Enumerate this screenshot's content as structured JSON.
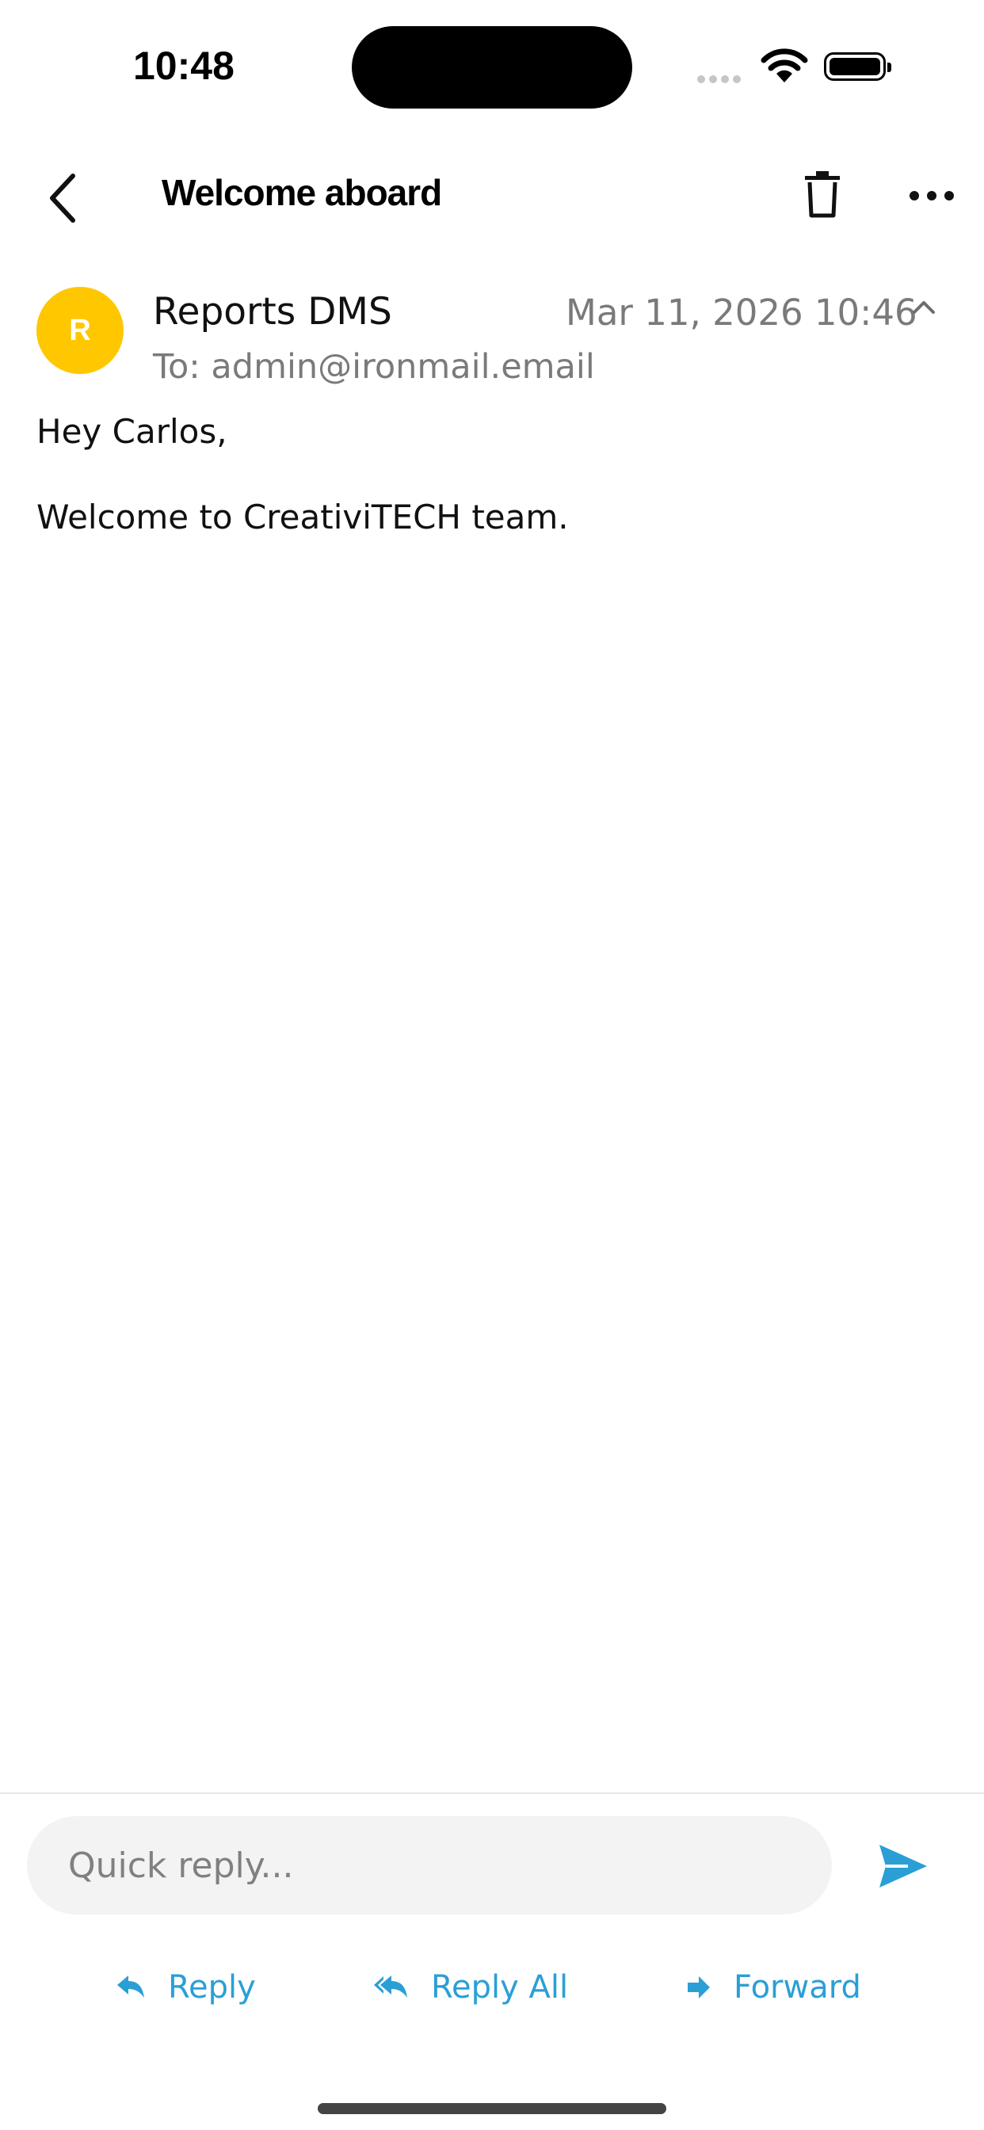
{
  "status_bar": {
    "time": "10:48"
  },
  "header": {
    "title": "Welcome aboard"
  },
  "message": {
    "avatar_initial": "R",
    "avatar_color": "#FFC700",
    "sender": "Reports DMS",
    "date": "Mar 11, 2026 10:46",
    "to": "To: admin@ironmail.email",
    "body": [
      "Hey Carlos,",
      "Welcome to CreativiTECH team."
    ]
  },
  "footer": {
    "quick_reply_placeholder": "Quick reply...",
    "reply_label": "Reply",
    "reply_all_label": "Reply All",
    "forward_label": "Forward",
    "accent_color": "#2A9FD6"
  },
  "icons": [
    "back-icon",
    "trash-icon",
    "more-icon",
    "chevron-up-icon",
    "send-icon",
    "reply-icon",
    "reply-all-icon",
    "forward-icon",
    "wifi-icon",
    "battery-icon"
  ]
}
